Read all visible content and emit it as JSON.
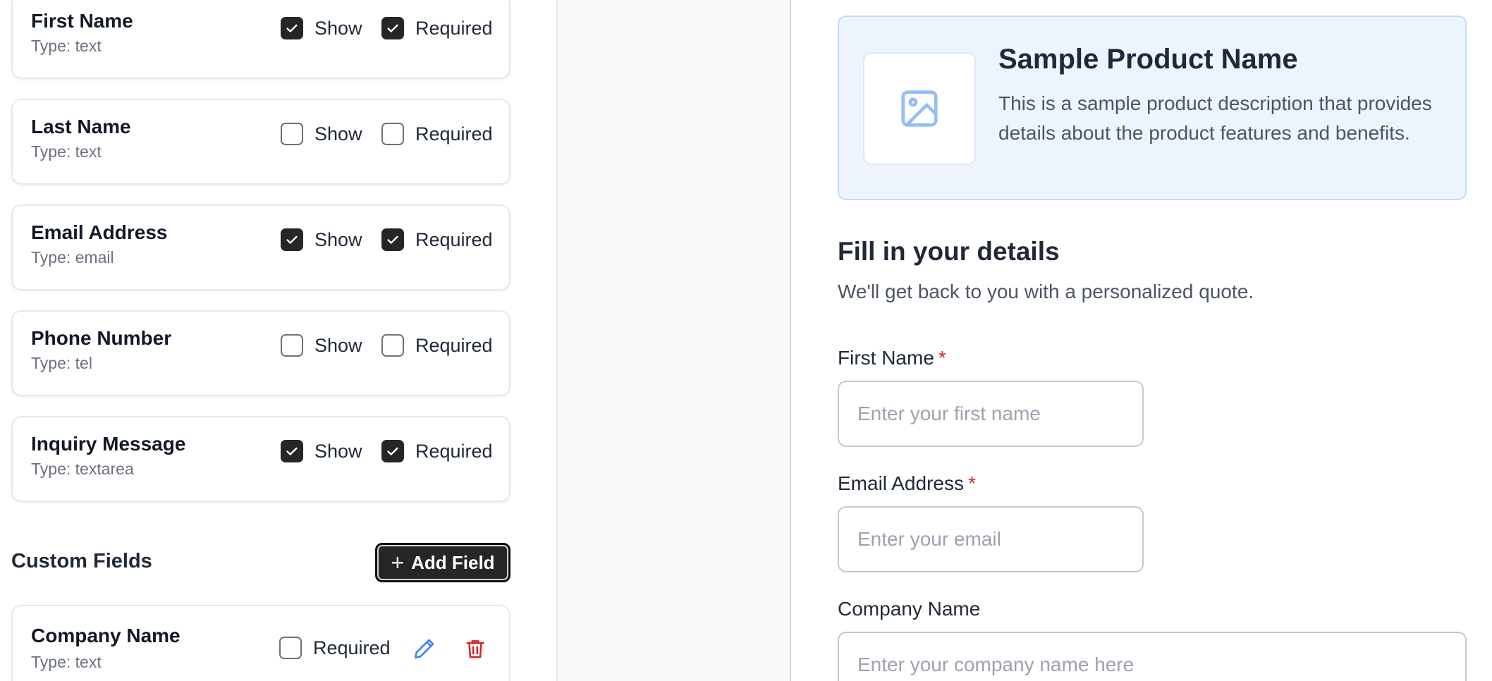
{
  "standard_fields": [
    {
      "name": "First Name",
      "type": "Type: text",
      "show": true,
      "required": true
    },
    {
      "name": "Last Name",
      "type": "Type: text",
      "show": false,
      "required": false
    },
    {
      "name": "Email Address",
      "type": "Type: email",
      "show": true,
      "required": true
    },
    {
      "name": "Phone Number",
      "type": "Type: tel",
      "show": false,
      "required": false
    },
    {
      "name": "Inquiry Message",
      "type": "Type: textarea",
      "show": true,
      "required": true
    }
  ],
  "labels": {
    "show": "Show",
    "required": "Required"
  },
  "custom_fields": {
    "title": "Custom Fields",
    "add_button": "Add Field",
    "items": [
      {
        "name": "Company Name",
        "type": "Type: text",
        "required": false
      }
    ]
  },
  "preview": {
    "product": {
      "name": "Sample Product Name",
      "description": "This is a sample product description that provides details about the product features and benefits."
    },
    "form_title": "Fill in your details",
    "form_subtitle": "We'll get back to you with a personalized quote.",
    "fields": [
      {
        "label": "First Name",
        "required_mark": "*",
        "placeholder": "Enter your first name"
      },
      {
        "label": "Email Address",
        "required_mark": "*",
        "placeholder": "Enter your email"
      },
      {
        "label": "Company Name",
        "placeholder": "Enter your company name here"
      }
    ]
  },
  "colors": {
    "accent_dark": "#262626",
    "required_star": "#dc2626",
    "edit_icon": "#3b82f6",
    "delete_icon": "#dc2626"
  },
  "icons": {
    "check": "check-icon",
    "plus": "plus-icon",
    "edit": "pencil-icon",
    "delete": "trash-icon",
    "image": "image-icon"
  }
}
